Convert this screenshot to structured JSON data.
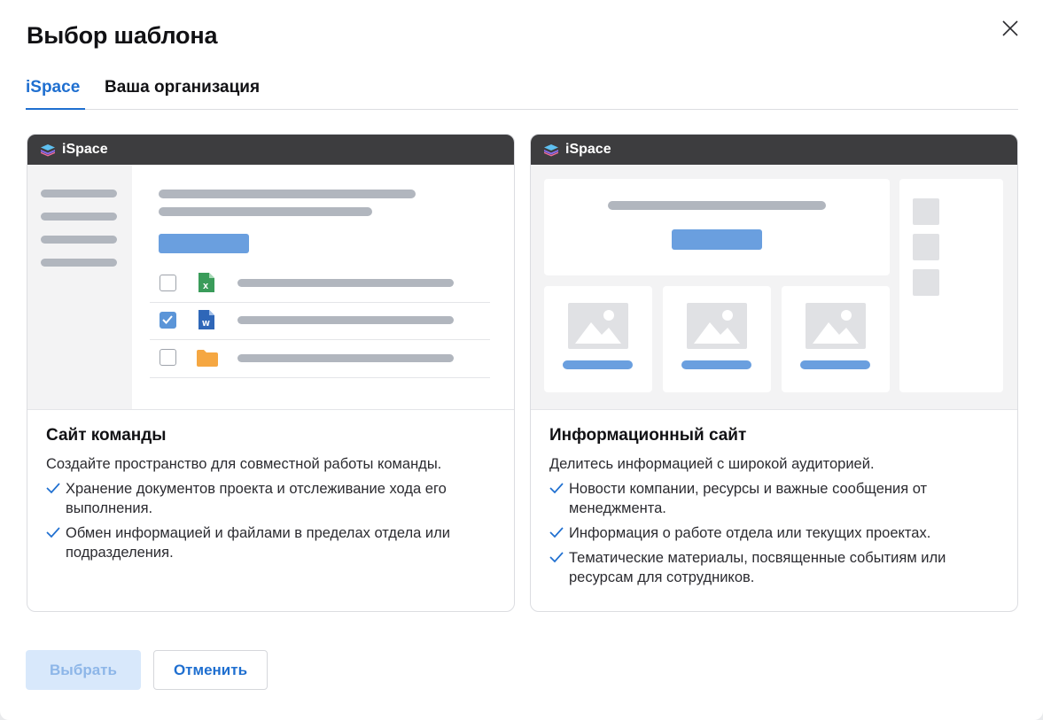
{
  "dialog": {
    "title": "Выбор шаблона",
    "close_icon": "close-icon"
  },
  "tabs": [
    {
      "label": "iSpace",
      "active": true
    },
    {
      "label": "Ваша организация",
      "active": false
    }
  ],
  "cards": [
    {
      "brand": "iSpace",
      "title": "Сайт команды",
      "description": "Создайте пространство для совместной работы команды.",
      "features": [
        "Хранение документов проекта и отслеживание хода его выполнения.",
        "Обмен информацией и файлами в пределах отдела или подразделения."
      ]
    },
    {
      "brand": "iSpace",
      "title": "Информационный сайт",
      "description": "Делитесь информацией с широкой аудиторией.",
      "features": [
        "Новости компании, ресурсы и важные сообщения от менеджмента.",
        "Информация о работе отдела или текущих проектах.",
        "Тематические материалы, посвященные событиям или ресурсам для сотрудников."
      ]
    }
  ],
  "preview_file_icons": [
    "excel-file-icon",
    "word-file-icon",
    "folder-icon"
  ],
  "buttons": {
    "select_label": "Выбрать",
    "select_disabled": true,
    "cancel_label": "Отменить"
  },
  "colors": {
    "accent": "#1f6fd0",
    "header_dark": "#3d3d3f",
    "excel_green": "#3a9c5a",
    "word_blue": "#2f67b8",
    "folder_orange": "#f5a742",
    "checkbox_blue": "#5b95d8"
  }
}
